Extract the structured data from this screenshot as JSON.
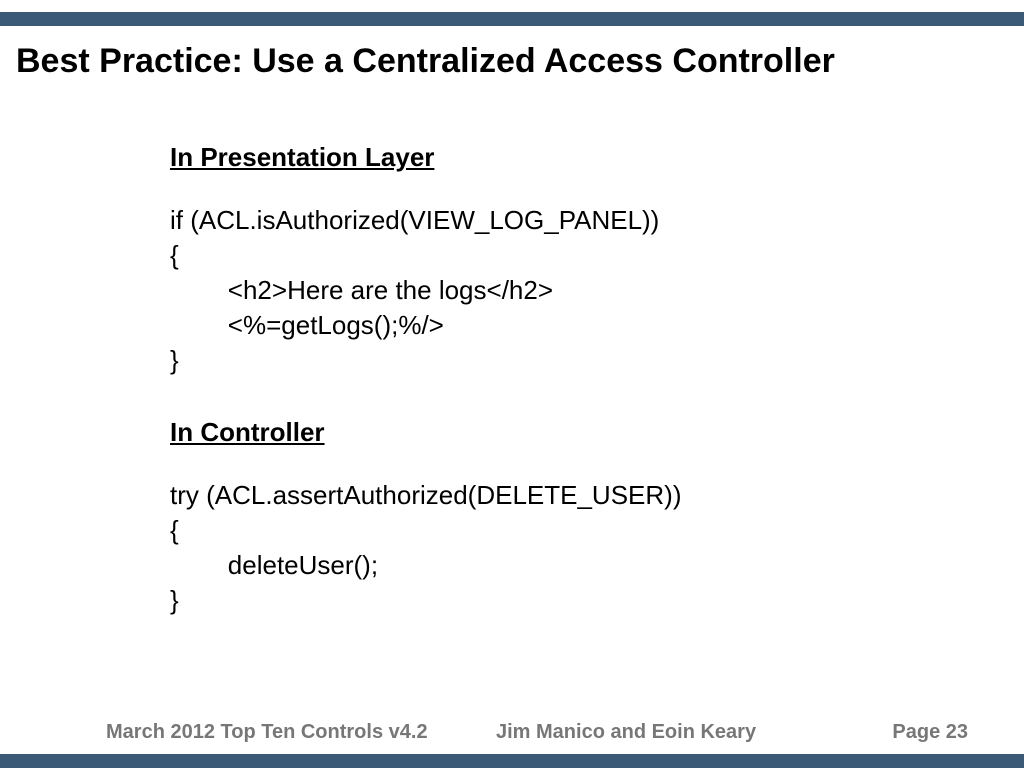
{
  "title": "Best Practice: Use a Centralized Access Controller",
  "sections": {
    "presentation": {
      "heading": "In Presentation Layer",
      "code": "if (ACL.isAuthorized(VIEW_LOG_PANEL))\n{\n        <h2>Here are the logs</h2>\n        <%=getLogs();%/>\n}"
    },
    "controller": {
      "heading": "In Controller",
      "code": "try (ACL.assertAuthorized(DELETE_USER))\n{\n        deleteUser();\n}"
    }
  },
  "footer": {
    "left": "March 2012  Top Ten Controls v4.2",
    "center": "Jim Manico and Eoin Keary",
    "right": "Page 23"
  }
}
